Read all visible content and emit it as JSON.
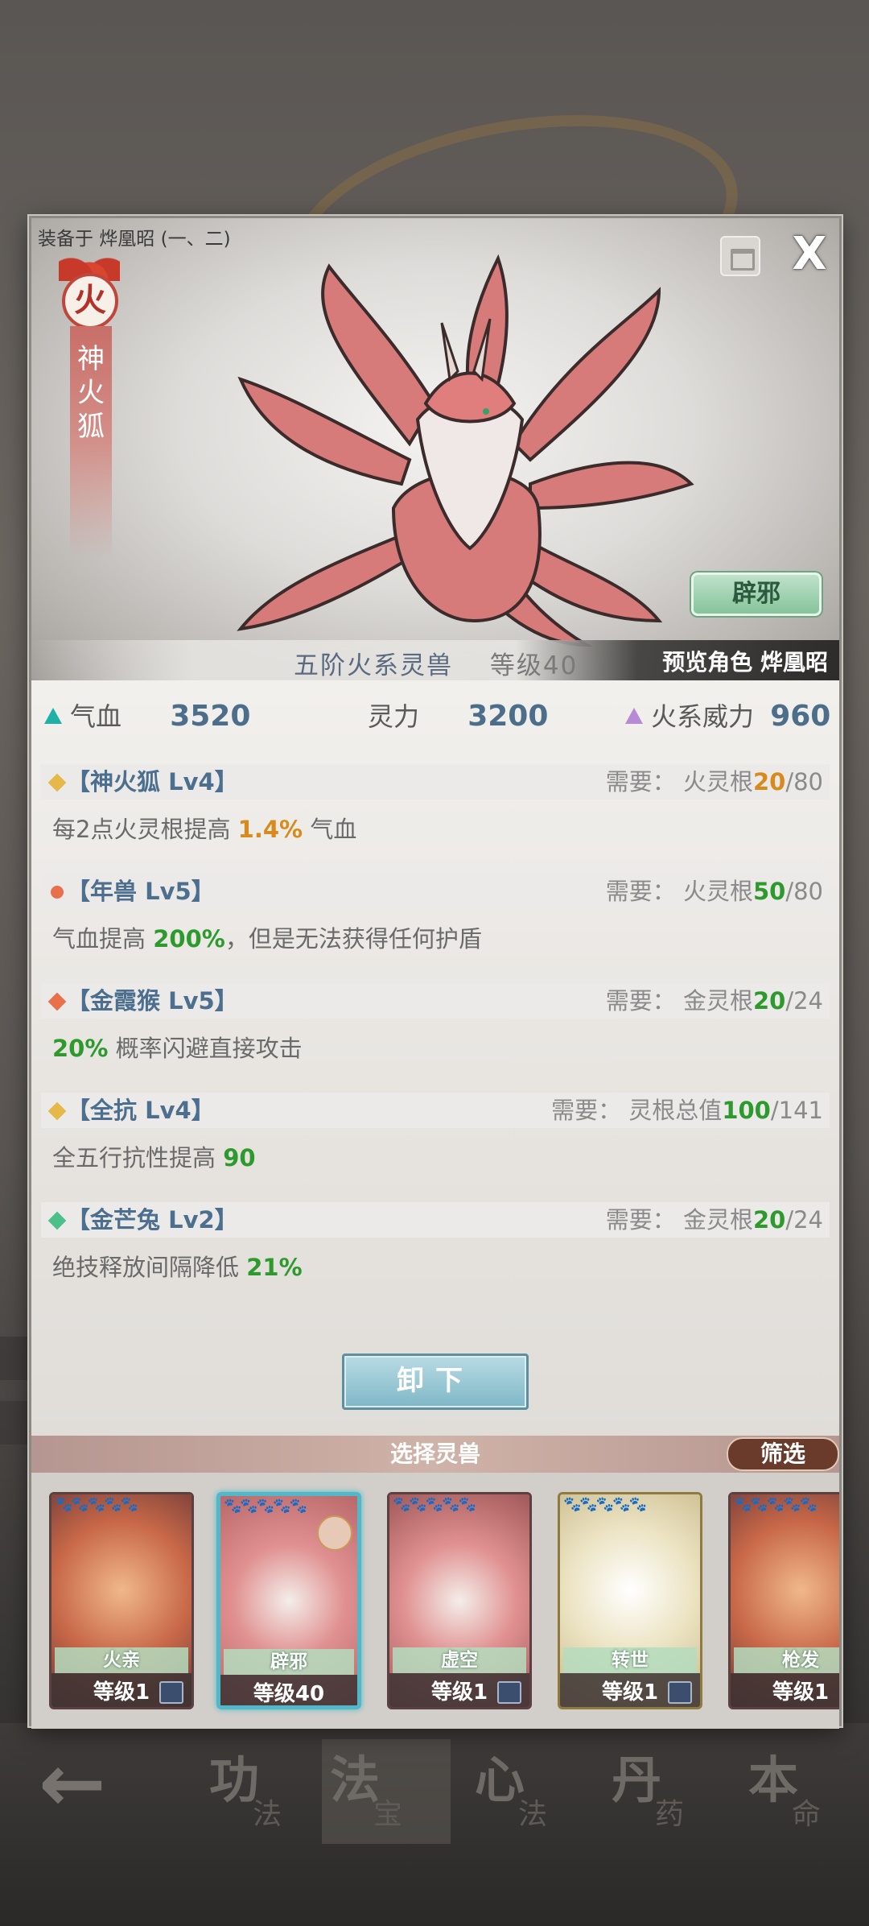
{
  "background_nav": {
    "items": [
      {
        "big": "功",
        "small": "法"
      },
      {
        "big": "法",
        "small": "宝"
      },
      {
        "big": "心",
        "small": "法"
      },
      {
        "big": "丹",
        "small": "药"
      },
      {
        "big": "本",
        "small": "命"
      }
    ],
    "back_icon": "left-arrow-icon"
  },
  "modal": {
    "equip_label": "装备于 烨凰昭 (一、二)",
    "close_label": "X",
    "element_char": "火",
    "beast_name_vertical": "神火狐",
    "skin_button": "辟邪",
    "rank_text": "五阶火系灵兽",
    "level_label": "等级",
    "level_value": "40",
    "preview_text": "预览角色 烨凰昭"
  },
  "stats": {
    "hp_label": "气血",
    "hp_value": "3520",
    "spirit_label": "灵力",
    "spirit_value": "3200",
    "fire_label": "火系威力",
    "fire_value": "960"
  },
  "skills": [
    {
      "name": "【神火狐 Lv4】",
      "icon_color": "#e6b84a",
      "req_label": "需要：",
      "req_attr": "火灵根",
      "req_have": "20",
      "req_sep": "/",
      "req_need": "80",
      "req_color": "#d98a1c",
      "desc_pre": "每2点火灵根提高 ",
      "desc_hl": "1.4%",
      "desc_post": " 气血",
      "hl_color": "#d98a1c"
    },
    {
      "name": "【年兽 Lv5】",
      "icon_color": "#e8704a",
      "req_label": "需要：",
      "req_attr": "火灵根",
      "req_have": "50",
      "req_sep": "/",
      "req_need": "80",
      "req_color": "#2e9a2e",
      "desc_pre": "气血提高 ",
      "desc_hl": "200%",
      "desc_post": "，但是无法获得任何护盾",
      "hl_color": "#2e9a2e"
    },
    {
      "name": "【金霞猴 Lv5】",
      "icon_color": "#e8704a",
      "req_label": "需要：",
      "req_attr": "金灵根",
      "req_have": "20",
      "req_sep": "/",
      "req_need": "24",
      "req_color": "#2e9a2e",
      "desc_pre": "",
      "desc_hl": "20%",
      "desc_post": " 概率闪避直接攻击",
      "hl_color": "#2e9a2e"
    },
    {
      "name": "【全抗 Lv4】",
      "icon_color": "#e6b84a",
      "req_label": "需要：",
      "req_attr": "灵根总值",
      "req_have": "100",
      "req_sep": "/",
      "req_need": "141",
      "req_color": "#2e9a2e",
      "desc_pre": "全五行抗性提高 ",
      "desc_hl": "90",
      "desc_post": "",
      "hl_color": "#2e9a2e"
    },
    {
      "name": "【金芒兔 Lv2】",
      "icon_color": "#4cc08a",
      "req_label": "需要：",
      "req_attr": "金灵根",
      "req_have": "20",
      "req_sep": "/",
      "req_need": "24",
      "req_color": "#2e9a2e",
      "desc_pre": "绝技释放间隔降低 ",
      "desc_hl": "21%",
      "desc_post": "",
      "hl_color": "#2e9a2e"
    }
  ],
  "unequip_button": "卸下",
  "select_title": "选择灵兽",
  "filter_button": "筛选",
  "cards": [
    {
      "name": "火亲",
      "level": "等级1",
      "theme": "phoenix",
      "locked": true
    },
    {
      "name": "辟邪",
      "level": "等级40",
      "theme": "fox",
      "locked": false,
      "selected": true
    },
    {
      "name": "虚空",
      "level": "等级1",
      "theme": "fox",
      "locked": true
    },
    {
      "name": "转世",
      "level": "等级1",
      "theme": "white",
      "locked": true
    },
    {
      "name": "枪发",
      "level": "等级1",
      "theme": "phoenix",
      "locked": false
    }
  ]
}
